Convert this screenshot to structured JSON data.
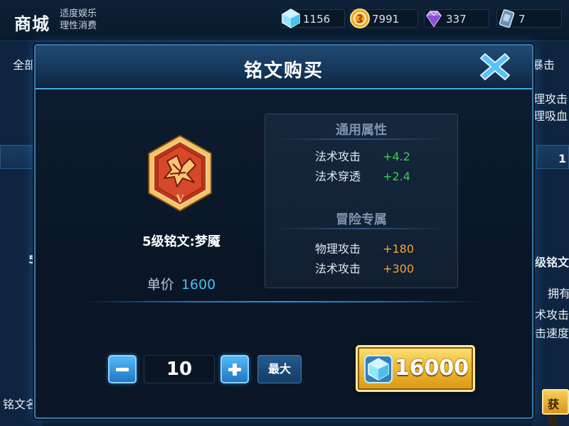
{
  "topbar": {
    "title": "商城",
    "slogan_line1": "适度娱乐",
    "slogan_line2": "理性消费",
    "currencies": [
      {
        "icon": "diamond-icon",
        "value": "1156"
      },
      {
        "icon": "gold-coin-icon",
        "value": "7991"
      },
      {
        "icon": "purple-gem-icon",
        "value": "337"
      },
      {
        "icon": "voucher-card-icon",
        "value": "7"
      }
    ]
  },
  "background": {
    "left_tab": "全部",
    "left_bottom": "铭文名",
    "left_num": "5",
    "right_tab": "暴击",
    "right_lines": [
      "理攻击",
      "理吸血"
    ],
    "right_name": "级铭文",
    "right_own": "拥有",
    "right_attr1": "术攻击",
    "right_attr2": "击速度",
    "right_price_prefix": "1",
    "right_get": "获取"
  },
  "dialog": {
    "title": "铭文购买",
    "item": {
      "name": "5级铭文:梦魇",
      "level_mark": "V",
      "price_label": "单价",
      "price_value": "1600"
    },
    "general": {
      "heading": "通用属性",
      "rows": [
        {
          "name": "法术攻击",
          "value": "+4.2"
        },
        {
          "name": "法术穿透",
          "value": "+2.4"
        }
      ]
    },
    "adventure": {
      "heading": "冒险专属",
      "rows": [
        {
          "name": "物理攻击",
          "value": "+180"
        },
        {
          "name": "法术攻击",
          "value": "+300"
        }
      ]
    },
    "quantity": "10",
    "max_label": "最大",
    "total": "16000"
  },
  "colors": {
    "accent_blue": "#3ec3f4",
    "stat_green": "#33d14f",
    "stat_orange": "#f2a437",
    "buy_gold": "#f0bb34"
  }
}
